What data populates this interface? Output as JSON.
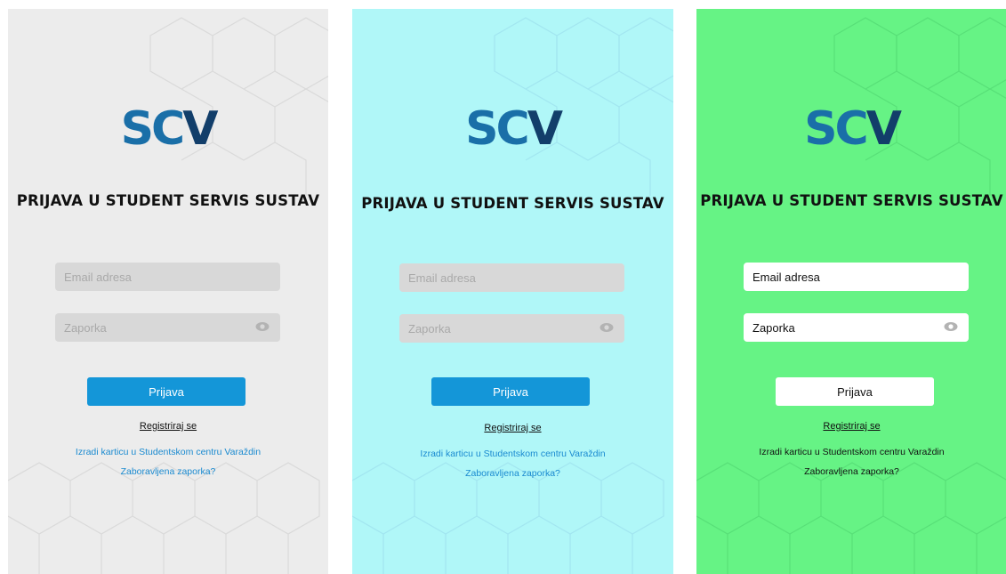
{
  "screens": [
    {
      "theme": "grey",
      "background": "#ececec",
      "logo": {
        "sc": "SC",
        "v": "V"
      },
      "title": "PRIJAVA U STUDENT SERVIS SUSTAV",
      "email_placeholder": "Email adresa",
      "password_placeholder": "Zaporka",
      "login_label": "Prijava",
      "register_label": "Registriraj se",
      "card_label": "Izradi karticu u Studentskom centru Varaždin",
      "forgot_label": "Zaboravljena zaporka?"
    },
    {
      "theme": "cyan",
      "background": "#b0f7f8",
      "logo": {
        "sc": "SC",
        "v": "V"
      },
      "title": "PRIJAVA U STUDENT SERVIS SUSTAV",
      "email_placeholder": "Email adresa",
      "password_placeholder": "Zaporka",
      "login_label": "Prijava",
      "register_label": "Registriraj se",
      "card_label": "Izradi karticu u Studentskom centru Varaždin",
      "forgot_label": "Zaboravljena zaporka?"
    },
    {
      "theme": "green",
      "background": "#66f385",
      "logo": {
        "sc": "SC",
        "v": "V"
      },
      "title": "PRIJAVA U STUDENT SERVIS SUSTAV",
      "email_placeholder": "Email adresa",
      "password_placeholder": "Zaporka",
      "login_label": "Prijava",
      "register_label": "Registriraj se",
      "card_label": "Izradi karticu u Studentskom centru Varaždin",
      "forgot_label": "Zaboravljena zaporka?"
    }
  ],
  "colors": {
    "logo_sc": "#1a6fa8",
    "logo_v": "#123e6a",
    "primary_button": "#1496d8",
    "link": "#1a8ad0"
  },
  "icons": {
    "password_toggle": "eye-icon",
    "background_pattern": "hexagon-pattern"
  }
}
